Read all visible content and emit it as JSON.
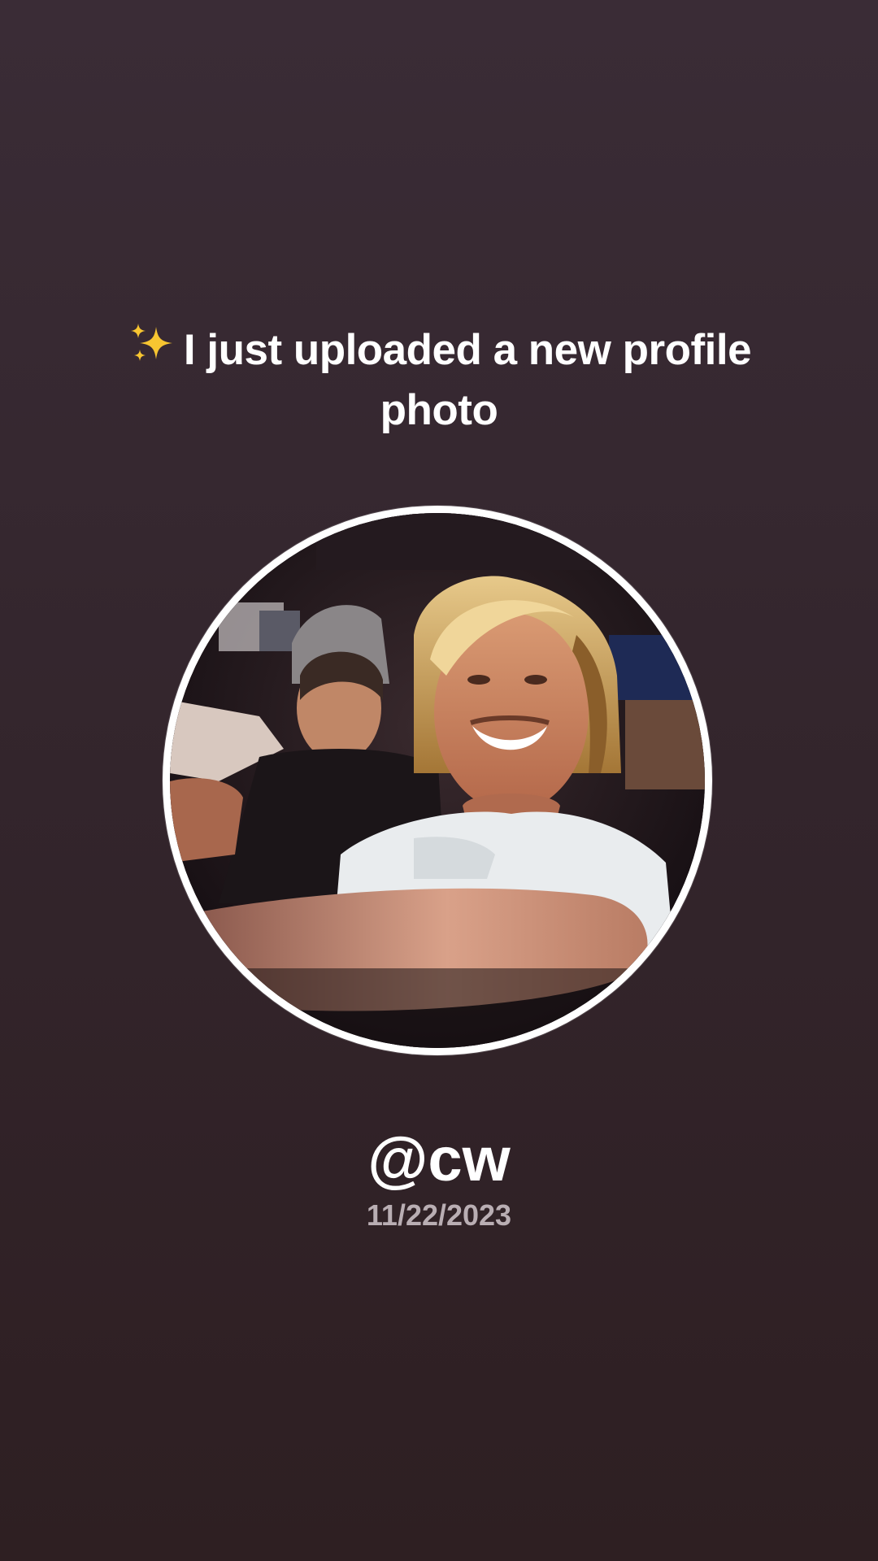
{
  "post": {
    "icon": "sparkles-icon",
    "headline": "I just uploaded a new profile photo",
    "handle": "@cw",
    "date": "11/22/2023"
  },
  "colors": {
    "background_top": "#3a2c36",
    "background_bottom": "#2e1f22",
    "ring": "#ffffff",
    "date_text": "#b9aeb3",
    "sparkle": "#f7c531"
  }
}
